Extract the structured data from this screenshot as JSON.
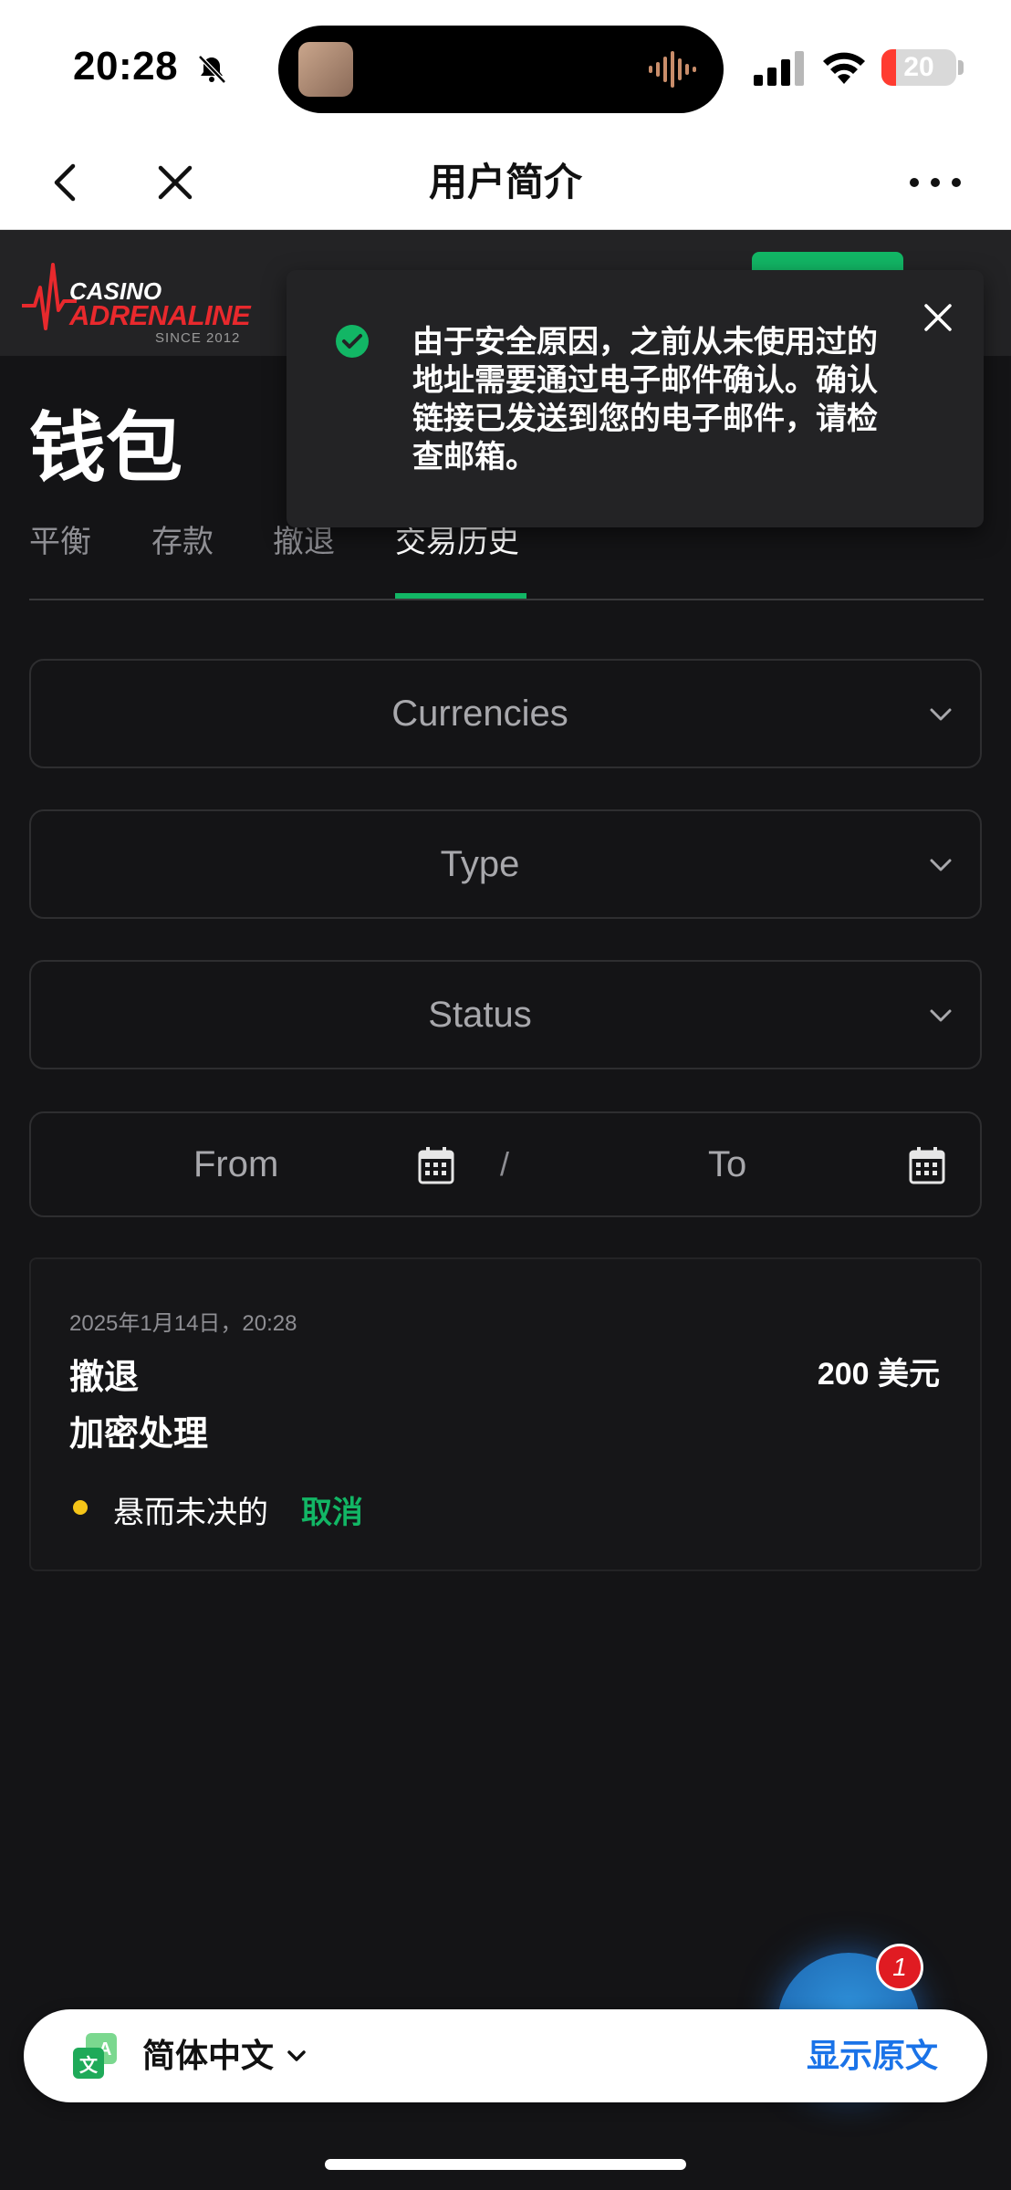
{
  "status_bar": {
    "time": "20:28",
    "battery": "20",
    "battery_level_percent": 20,
    "icons": [
      "bell-slash-icon",
      "signal-icon",
      "wifi-icon",
      "battery-icon"
    ]
  },
  "nav": {
    "title": "用户简介",
    "icons": [
      "back-arrow-icon",
      "close-icon",
      "more-icon"
    ]
  },
  "site": {
    "logo_line1": "CASINO",
    "logo_line2": "ADRENALINE",
    "logo_since": "SINCE 2012",
    "accent_color": "#12b665",
    "brand_red": "#e8292d"
  },
  "wallet": {
    "title": "钱包",
    "tabs": [
      {
        "label": "平衡"
      },
      {
        "label": "存款"
      },
      {
        "label": "撤退"
      },
      {
        "label": "交易历史",
        "active": true
      }
    ],
    "filters": {
      "currencies": "Currencies",
      "type": "Type",
      "status": "Status",
      "from": "From",
      "separator": "/",
      "to": "To"
    },
    "transaction": {
      "date": "2025年1月14日，20:28",
      "type": "撤退",
      "method": "加密处理",
      "amount": "200 美元",
      "status": "悬而未决的",
      "cancel": "取消",
      "status_color": "#f5c518"
    }
  },
  "toast": {
    "message": "由于安全原因，之前从未使用过的地址需要通过电子邮件确认。确认链接已发送到您的电子邮件，请检查邮箱。"
  },
  "chat": {
    "badge": "1"
  },
  "translate_bar": {
    "language": "简体中文",
    "show_original": "显示原文"
  }
}
